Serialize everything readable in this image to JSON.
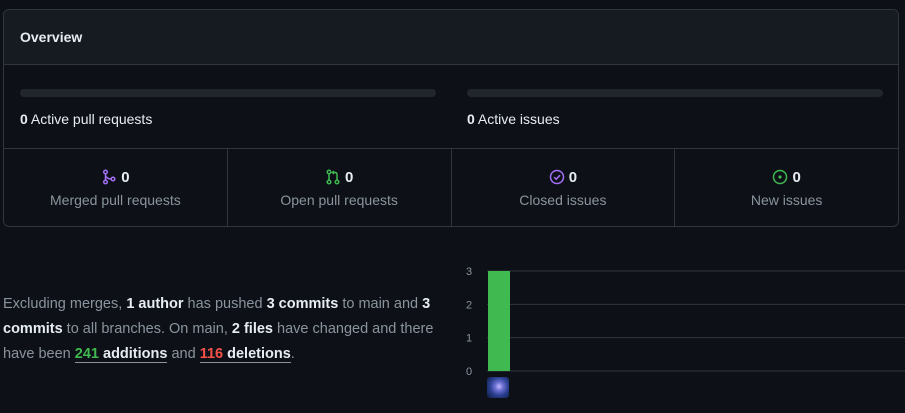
{
  "overview": {
    "title": "Overview",
    "active_prs": {
      "count": "0",
      "label": "Active pull requests",
      "progress": 0
    },
    "active_issues": {
      "count": "0",
      "label": "Active issues",
      "progress": 0
    },
    "stats": [
      {
        "icon": "merged-pr-icon",
        "count": "0",
        "label": "Merged pull requests",
        "color": "#a371f7"
      },
      {
        "icon": "open-pr-icon",
        "count": "0",
        "label": "Open pull requests",
        "color": "#3fb950"
      },
      {
        "icon": "closed-issue-icon",
        "count": "0",
        "label": "Closed issues",
        "color": "#a371f7"
      },
      {
        "icon": "open-issue-icon",
        "count": "0",
        "label": "New issues",
        "color": "#3fb950"
      }
    ]
  },
  "summary": {
    "p1": "Excluding merges, ",
    "authors": "1 author",
    "p2": " has pushed ",
    "commits_main": "3 commits",
    "p3": " to main and ",
    "commits_all": "3 commits",
    "p4": " to all branches. On main, ",
    "files": "2 files",
    "p5": " have changed and there have been ",
    "additions_num": "241",
    "additions_word": "additions",
    "p6": " and ",
    "deletions_num": "116",
    "deletions_word": "deletions",
    "p7": "."
  },
  "colors": {
    "accent_green": "#3fb950",
    "bar_green": "#40b950",
    "deletion_red": "#f85149",
    "muted": "#8b949e"
  },
  "chart_data": {
    "type": "bar",
    "categories": [
      ""
    ],
    "values": [
      3
    ],
    "ylim": [
      0,
      3
    ],
    "yticks": [
      "0",
      "1",
      "2",
      "3"
    ],
    "grid": true,
    "xlabel": "",
    "ylabel": "",
    "title": ""
  }
}
